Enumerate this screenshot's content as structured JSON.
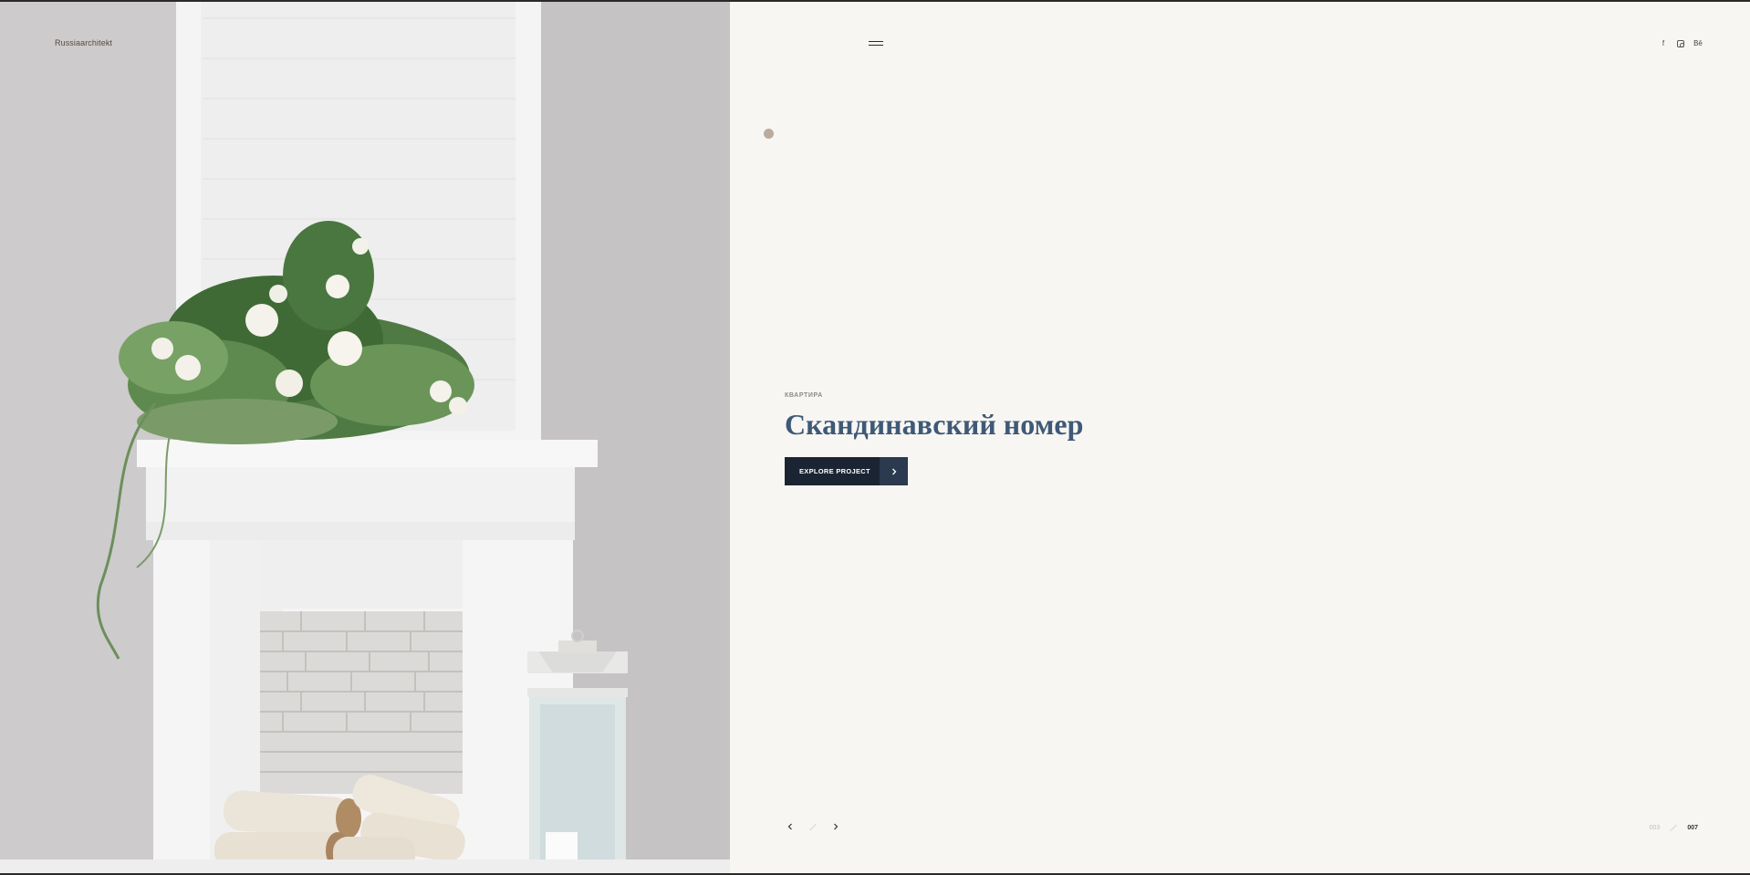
{
  "brand": {
    "name": "Russiaarchitekt"
  },
  "social": {
    "facebook": "f",
    "behance": "Bē"
  },
  "hero": {
    "category": "КВАРТИРА",
    "title": "Скандинавский номер",
    "cta_label": "EXPLORE PROJECT"
  },
  "slider": {
    "current": "003",
    "total": "007"
  },
  "colors": {
    "accent_dark": "#1a2433",
    "title_blue": "#3f5977",
    "dot": "#b8aba0",
    "panel_bg": "#f7f6f2"
  },
  "icons": {
    "menu": "hamburger-icon",
    "facebook": "facebook-icon",
    "instagram": "instagram-icon",
    "behance": "behance-icon",
    "prev": "chevron-left-icon",
    "next": "chevron-right-icon",
    "cta": "chevron-right-icon"
  }
}
